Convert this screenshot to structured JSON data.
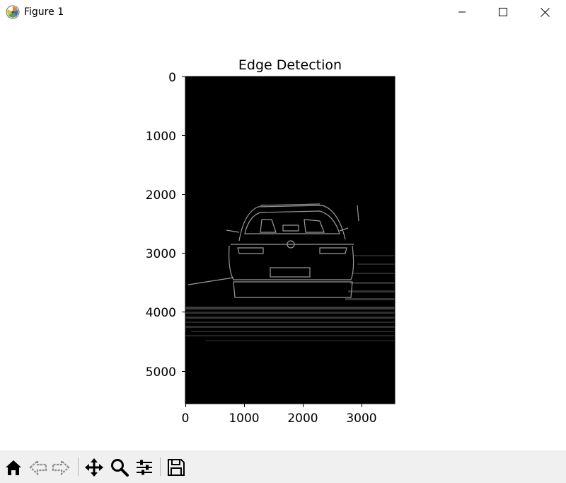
{
  "window": {
    "title": "Figure 1",
    "controls": [
      "minimize",
      "maximize",
      "close"
    ]
  },
  "figure": {
    "title": "Edge Detection",
    "image": {
      "description_kind": "edge-map",
      "background": "#000000",
      "edge_color": "#d0d0d0"
    },
    "x_axis": {
      "ticks": [
        "0",
        "1000",
        "2000",
        "3000"
      ]
    },
    "y_axis": {
      "ticks": [
        "0",
        "1000",
        "2000",
        "3000",
        "4000",
        "5000"
      ]
    }
  },
  "toolbar": {
    "buttons": [
      {
        "name": "home",
        "icon": "home-icon"
      },
      {
        "name": "back",
        "icon": "back-arrow-icon"
      },
      {
        "name": "forward",
        "icon": "forward-arrow-icon"
      },
      {
        "name": "pan",
        "icon": "pan-move-icon"
      },
      {
        "name": "zoom",
        "icon": "zoom-magnifier-icon"
      },
      {
        "name": "configure-subplots",
        "icon": "sliders-icon"
      },
      {
        "name": "save",
        "icon": "floppy-disk-icon"
      }
    ]
  }
}
